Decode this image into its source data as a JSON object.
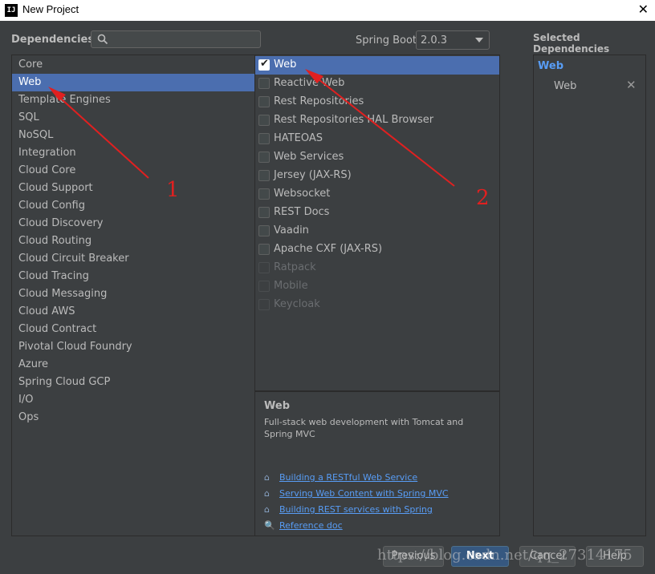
{
  "window": {
    "title": "New Project",
    "app_icon": "IJ",
    "close_glyph": "✕"
  },
  "header": {
    "dependencies_label": "Dependencies",
    "search": {
      "value": "",
      "placeholder": ""
    },
    "spring_boot_label": "Spring Boot",
    "spring_boot_version": "2.0.3"
  },
  "categories": {
    "selected": "Web",
    "items": [
      "Core",
      "Web",
      "Template Engines",
      "SQL",
      "NoSQL",
      "Integration",
      "Cloud Core",
      "Cloud Support",
      "Cloud Config",
      "Cloud Discovery",
      "Cloud Routing",
      "Cloud Circuit Breaker",
      "Cloud Tracing",
      "Cloud Messaging",
      "Cloud AWS",
      "Cloud Contract",
      "Pivotal Cloud Foundry",
      "Azure",
      "Spring Cloud GCP",
      "I/O",
      "Ops"
    ]
  },
  "dependencies": [
    {
      "label": "Web",
      "checked": true,
      "disabled": false
    },
    {
      "label": "Reactive Web",
      "checked": false,
      "disabled": false
    },
    {
      "label": "Rest Repositories",
      "checked": false,
      "disabled": false
    },
    {
      "label": "Rest Repositories HAL Browser",
      "checked": false,
      "disabled": false
    },
    {
      "label": "HATEOAS",
      "checked": false,
      "disabled": false
    },
    {
      "label": "Web Services",
      "checked": false,
      "disabled": false
    },
    {
      "label": "Jersey (JAX-RS)",
      "checked": false,
      "disabled": false
    },
    {
      "label": "Websocket",
      "checked": false,
      "disabled": false
    },
    {
      "label": "REST Docs",
      "checked": false,
      "disabled": false
    },
    {
      "label": "Vaadin",
      "checked": false,
      "disabled": false
    },
    {
      "label": "Apache CXF (JAX-RS)",
      "checked": false,
      "disabled": false
    },
    {
      "label": "Ratpack",
      "checked": false,
      "disabled": true
    },
    {
      "label": "Mobile",
      "checked": false,
      "disabled": true
    },
    {
      "label": "Keycloak",
      "checked": false,
      "disabled": true
    }
  ],
  "description": {
    "title": "Web",
    "text": "Full-stack web development with Tomcat and Spring MVC",
    "links": [
      {
        "label": "Building a RESTful Web Service",
        "icon": "home-icon"
      },
      {
        "label": "Serving Web Content with Spring MVC",
        "icon": "home-icon"
      },
      {
        "label": "Building REST services with Spring",
        "icon": "home-icon"
      },
      {
        "label": "Reference doc",
        "icon": "doc-search-icon"
      }
    ]
  },
  "selected_dependencies": {
    "title": "Selected Dependencies",
    "group": "Web",
    "items": [
      {
        "label": "Web"
      }
    ]
  },
  "buttons": {
    "previous": "Previous",
    "next": "Next",
    "cancel": "Cancel",
    "help": "Help"
  },
  "annotations": {
    "arrow1_label": "1",
    "arrow2_label": "2",
    "arrow_color": "#e02020"
  },
  "watermark": "https://blog.csdn.net/qq_27314175",
  "colors": {
    "background": "#3c3f41",
    "selection": "#4b6eaf",
    "link": "#589df6",
    "primary_button": "#365880"
  }
}
